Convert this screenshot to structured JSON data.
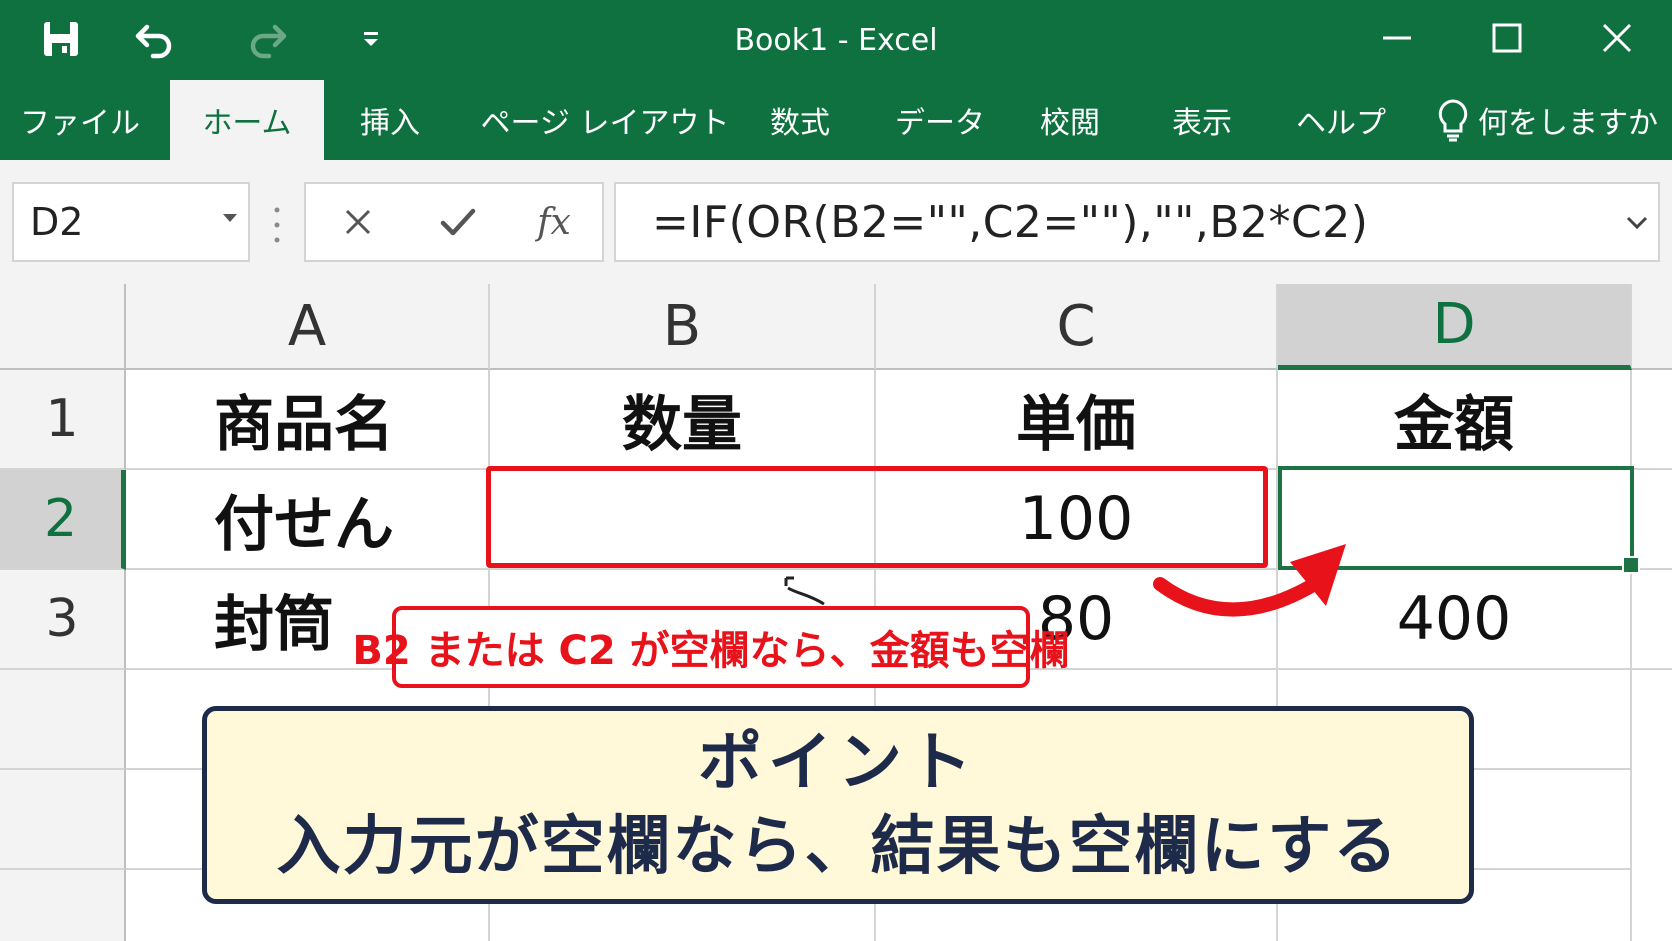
{
  "window": {
    "title": "Book1  -  Excel"
  },
  "ribbon": {
    "tabs": [
      {
        "label": "ファイル"
      },
      {
        "label": "ホーム"
      },
      {
        "label": "挿入"
      },
      {
        "label": "ページ レイアウト"
      },
      {
        "label": "数式"
      },
      {
        "label": "データ"
      },
      {
        "label": "校閲"
      },
      {
        "label": "表示"
      },
      {
        "label": "ヘルプ"
      }
    ],
    "active_tab": "ホーム",
    "tell_me": "何をしますか"
  },
  "formula_bar": {
    "name_box": "D2",
    "fx_label": "fx",
    "formula": "=IF(OR(B2=\"\",C2=\"\"),\"\",B2*C2)"
  },
  "grid": {
    "columns": [
      "A",
      "B",
      "C",
      "D"
    ],
    "selected_column": "D",
    "rows": [
      "1",
      "2",
      "3"
    ],
    "selected_row": "2",
    "cells": {
      "A1": "商品名",
      "B1": "数量",
      "C1": "単価",
      "D1": "金額",
      "A2": "付せん",
      "B2": "",
      "C2": "100",
      "D2": "",
      "A3": "封筒",
      "B3": "",
      "C3": "80",
      "D3": "400"
    },
    "active_cell": "D2"
  },
  "annotations": {
    "red_label": "B2 または C2 が空欄なら、金額も空欄",
    "point_title": "ポイント",
    "point_body": "入力元が空欄なら、結果も空欄にする"
  },
  "colors": {
    "excel_green": "#0f7140",
    "highlight_red": "#e8131a",
    "point_fill": "#fff9d9",
    "point_border": "#1e2a4a"
  }
}
